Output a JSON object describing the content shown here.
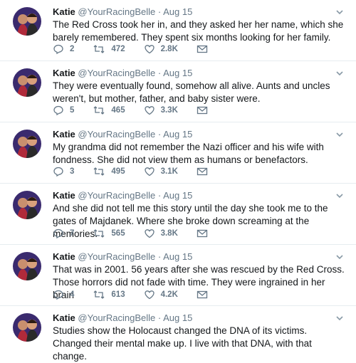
{
  "tweets": [
    {
      "name": "Katie",
      "handle": "@YourRacingBelle",
      "date": "Aug 15",
      "text": "The Red Cross took her in, and they asked her her name, which she barely remembered. They spent six months looking for her family.",
      "replies": "2",
      "retweets": "472",
      "likes": "2.8K"
    },
    {
      "name": "Katie",
      "handle": "@YourRacingBelle",
      "date": "Aug 15",
      "text": "They were eventually found, somehow all alive. Aunts and uncles weren't, but mother, father, and baby sister were.",
      "replies": "5",
      "retweets": "465",
      "likes": "3.3K"
    },
    {
      "name": "Katie",
      "handle": "@YourRacingBelle",
      "date": "Aug 15",
      "text": "My grandma did not remember the Nazi officer and his wife with fondness. She did not view them as humans or benefactors.",
      "replies": "3",
      "retweets": "495",
      "likes": "3.1K"
    },
    {
      "name": "Katie",
      "handle": "@YourRacingBelle",
      "date": "Aug 15",
      "text": "And she did not tell me this story until the day she took me to the gates of Majdanek. Where she broke down screaming at the memories.",
      "replies": "7",
      "retweets": "565",
      "likes": "3.8K"
    },
    {
      "name": "Katie",
      "handle": "@YourRacingBelle",
      "date": "Aug 15",
      "text": "That was in 2001. 56 years after she was rescued by the Red Cross. Those horrors did not fade with time. They were ingrained in her brain",
      "replies": "4",
      "retweets": "613",
      "likes": "4.2K"
    },
    {
      "name": "Katie",
      "handle": "@YourRacingBelle",
      "date": "Aug 15",
      "text": "Studies show the Holocaust changed the DNA of its victims. Changed their mental make up. I live with that DNA, with that change.",
      "replies": "",
      "retweets": "",
      "likes": ""
    }
  ],
  "separator": "·",
  "icons": {
    "avatar": "user-avatar",
    "reply": "reply-icon",
    "retweet": "retweet-icon",
    "like": "heart-icon",
    "dm": "envelope-icon",
    "menu": "chevron-down-icon"
  },
  "colors": {
    "text": "#14171a",
    "muted": "#657786",
    "border": "#e6ecf0"
  }
}
